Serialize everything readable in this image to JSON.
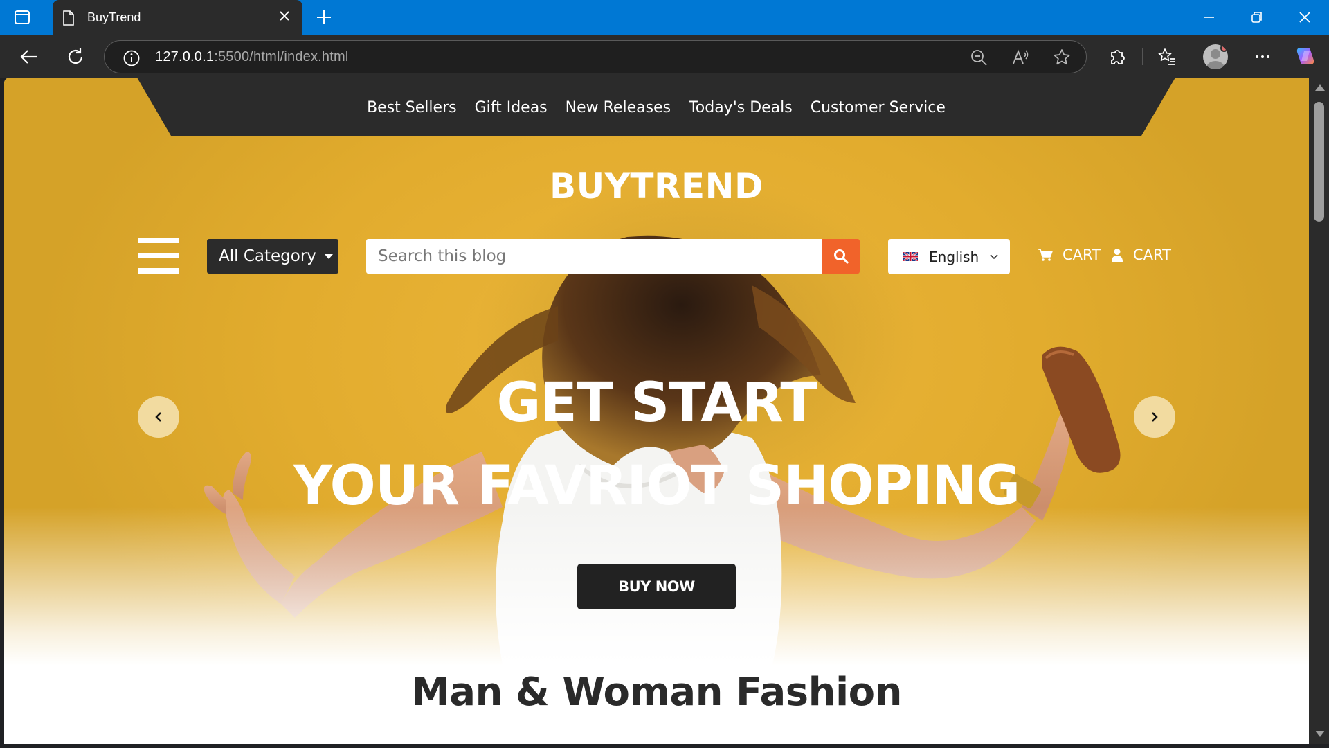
{
  "browser": {
    "tab_title": "BuyTrend",
    "url_host": "127.0.0.1",
    "url_rest": ":5500/html/index.html"
  },
  "topnav": {
    "links": [
      "Best Sellers",
      "Gift Ideas",
      "New Releases",
      "Today's Deals",
      "Customer Service"
    ]
  },
  "header": {
    "brand": "BUYTREND",
    "category_label": "All Category",
    "search_placeholder": "Search this blog",
    "language": "English",
    "cart_label_1": "CART",
    "cart_label_2": "CART"
  },
  "hero": {
    "line1": "GET START",
    "line2": "YOUR FAVRIOT SHOPING",
    "button": "BUY NOW"
  },
  "section": {
    "title": "Man & Woman Fashion"
  },
  "colors": {
    "hero_bg": "#e2ac2e",
    "accent": "#f1632a",
    "dark": "#2b2b2b",
    "browser_accent": "#0078d4"
  },
  "icons": [
    "tab-actions-icon",
    "page-icon",
    "close-icon",
    "plus-icon",
    "minimize-icon",
    "restore-icon",
    "window-close-icon",
    "back-icon",
    "refresh-icon",
    "info-icon",
    "zoom-out-icon",
    "read-aloud-icon",
    "favorite-star-icon",
    "extensions-icon",
    "favorites-icon",
    "more-icon",
    "copilot-icon",
    "hamburger-icon",
    "caret-down-icon",
    "search-icon",
    "uk-flag-icon",
    "chevron-down-icon",
    "cart-icon",
    "user-icon",
    "chevron-left-icon",
    "chevron-right-icon"
  ]
}
